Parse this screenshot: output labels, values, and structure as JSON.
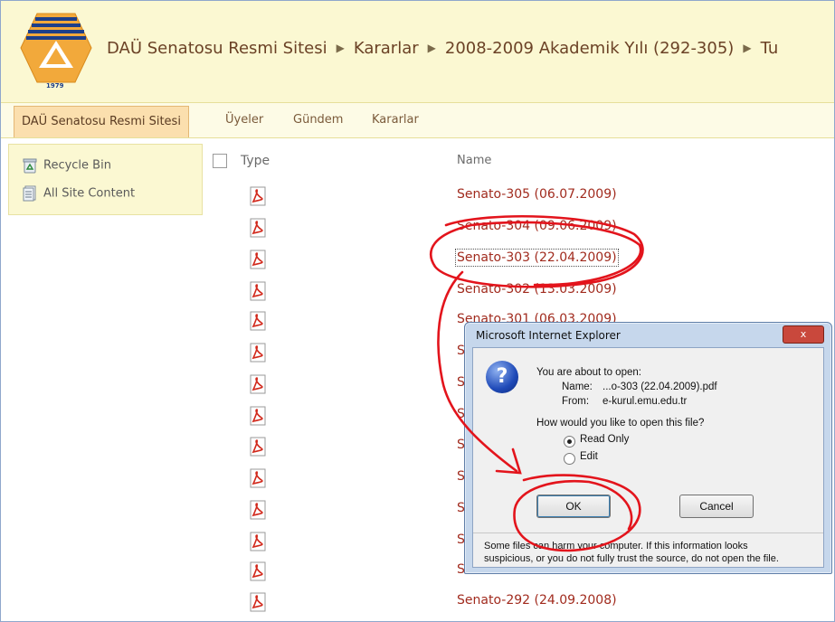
{
  "breadcrumb": [
    "DAÜ Senatosu Resmi Sitesi",
    "Kararlar",
    "2008-2009 Akademik Yılı (292-305)",
    "Tu"
  ],
  "logo": {
    "year": "1979"
  },
  "topnav": [
    "DAÜ Senatosu Resmi Sitesi",
    "Üyeler",
    "Gündem",
    "Kararlar"
  ],
  "sidebar": [
    "Recycle Bin",
    "All Site Content"
  ],
  "list": {
    "type_header": "Type",
    "name_header": "Name",
    "rows": [
      "Senato-305 (06.07.2009)",
      "Senato-304 (09.06.2009)",
      "Senato-303 (22.04.2009)",
      "Senato-302 (13.03.2009)",
      "Senato-301 (06.03.2009)",
      "S",
      "S",
      "S",
      "S",
      "S",
      "S",
      "S",
      "S",
      "Senato-292 (24.09.2008)"
    ]
  },
  "dialog": {
    "title": "Microsoft Internet Explorer",
    "close": "x",
    "intro": "You are about to open:",
    "name_label": "Name:",
    "name_value": "...o-303 (22.04.2009).pdf",
    "from_label": "From:",
    "from_value": "e-kurul.emu.edu.tr",
    "question": "How would you like to open this file?",
    "opt_read": "Read Only",
    "opt_edit": "Edit",
    "ok": "OK",
    "cancel": "Cancel",
    "warn1": "Some files can harm your computer. If this information looks",
    "warn2": "suspicious, or you do not fully trust the source, do not open the file."
  },
  "colors": {
    "link": "#a12b1e",
    "header_bg": "#fbf8d2",
    "annotation": "#e3141c"
  }
}
